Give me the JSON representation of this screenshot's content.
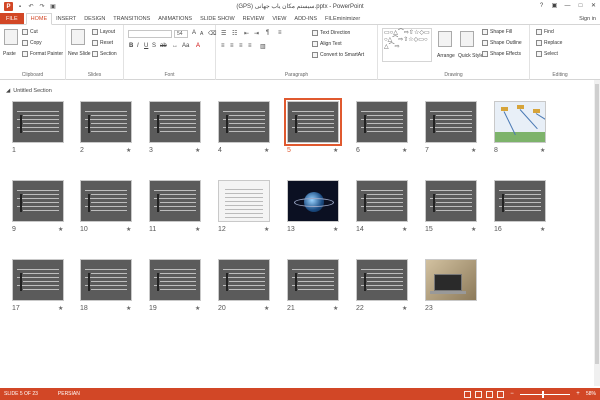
{
  "window": {
    "title": "(GPS) سیستم مکان یاب جهانی.pptx - PowerPoint",
    "controls": [
      "?",
      "▣",
      "—",
      "□",
      "✕"
    ]
  },
  "qat": {
    "app_letter": "P",
    "icons": [
      "save-icon",
      "undo-icon",
      "redo-icon",
      "start-from-beginning-icon"
    ]
  },
  "tabs": [
    "FILE",
    "HOME",
    "INSERT",
    "DESIGN",
    "TRANSITIONS",
    "ANIMATIONS",
    "SLIDE SHOW",
    "REVIEW",
    "VIEW",
    "ADD-INS",
    "FILEminimizer"
  ],
  "active_tab": "HOME",
  "signin": "Sign in",
  "ribbon": {
    "clipboard": {
      "label": "Clipboard",
      "paste": "Paste",
      "cut": "Cut",
      "copy": "Copy",
      "format_painter": "Format Painter"
    },
    "slides": {
      "label": "Slides",
      "new_slide": "New Slide",
      "layout": "Layout",
      "reset": "Reset",
      "section": "Section"
    },
    "font": {
      "label": "Font",
      "size": "54",
      "name": ""
    },
    "paragraph": {
      "label": "Paragraph",
      "text_direction": "Text Direction",
      "align_text": "Align Text",
      "convert": "Convert to SmartArt"
    },
    "drawing": {
      "label": "Drawing",
      "arrange": "Arrange",
      "quick_styles": "Quick Styles",
      "shape_fill": "Shape Fill",
      "shape_outline": "Shape Outline",
      "shape_effects": "Shape Effects"
    },
    "editing": {
      "label": "Editing",
      "find": "Find",
      "replace": "Replace",
      "select": "Select"
    }
  },
  "section": {
    "name": "Untitled Section"
  },
  "selected_slide": 5,
  "slides": [
    {
      "n": "1",
      "kind": "gps",
      "star": false
    },
    {
      "n": "2",
      "kind": "gps",
      "star": true
    },
    {
      "n": "3",
      "kind": "gps",
      "star": true
    },
    {
      "n": "4",
      "kind": "gps",
      "star": true
    },
    {
      "n": "5",
      "kind": "gps",
      "star": true
    },
    {
      "n": "6",
      "kind": "gps",
      "star": true
    },
    {
      "n": "7",
      "kind": "gps",
      "star": true
    },
    {
      "n": "8",
      "kind": "diagram",
      "star": true
    },
    {
      "n": "9",
      "kind": "gps",
      "star": true
    },
    {
      "n": "10",
      "kind": "gps",
      "star": true
    },
    {
      "n": "11",
      "kind": "gps",
      "star": true
    },
    {
      "n": "12",
      "kind": "table",
      "star": true
    },
    {
      "n": "13",
      "kind": "space",
      "star": true
    },
    {
      "n": "14",
      "kind": "gps",
      "star": true
    },
    {
      "n": "15",
      "kind": "gps",
      "star": true
    },
    {
      "n": "16",
      "kind": "gps",
      "star": true
    },
    {
      "n": "17",
      "kind": "gps",
      "star": true
    },
    {
      "n": "18",
      "kind": "gps",
      "star": true
    },
    {
      "n": "19",
      "kind": "gps",
      "star": true
    },
    {
      "n": "20",
      "kind": "gps",
      "star": true
    },
    {
      "n": "21",
      "kind": "gps",
      "star": true
    },
    {
      "n": "22",
      "kind": "gps",
      "star": true
    },
    {
      "n": "23",
      "kind": "photo",
      "star": false
    }
  ],
  "statusbar": {
    "slide_of": "SLIDE 5 OF 23",
    "language": "PERSIAN",
    "zoom": "58%"
  },
  "colors": {
    "accent": "#d24726",
    "selection": "#e0592f",
    "slide_bg": "#5b5b5b"
  }
}
